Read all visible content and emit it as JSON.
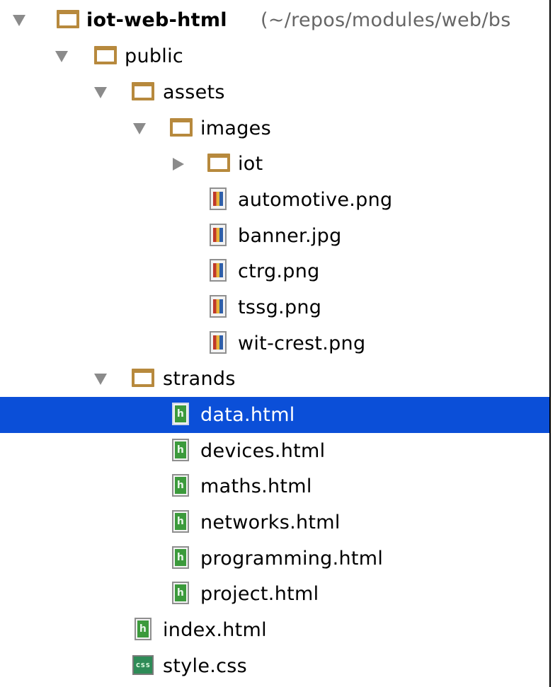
{
  "root": {
    "name": "iot-web-html",
    "path": "(~/repos/modules/web/bs"
  },
  "items": {
    "public": "public",
    "assets": "assets",
    "images": "images",
    "iot": "iot",
    "automotive": "automotive.png",
    "banner": "banner.jpg",
    "ctrg": "ctrg.png",
    "tssg": "tssg.png",
    "wit_crest": "wit-crest.png",
    "strands": "strands",
    "data": "data.html",
    "devices": "devices.html",
    "maths": "maths.html",
    "networks": "networks.html",
    "programming": "programming.html",
    "project": "project.html",
    "index": "index.html",
    "style": "style.css"
  },
  "icons": {
    "folder": "folder-icon",
    "html": "html-file-icon",
    "image": "image-file-icon",
    "css": "css-file-icon",
    "expanded": "triangle-down-icon",
    "collapsed": "triangle-right-icon"
  },
  "colors": {
    "selection": "#0b4fd8",
    "folder": "#b7893d",
    "html_badge": "#3c9a3c"
  }
}
